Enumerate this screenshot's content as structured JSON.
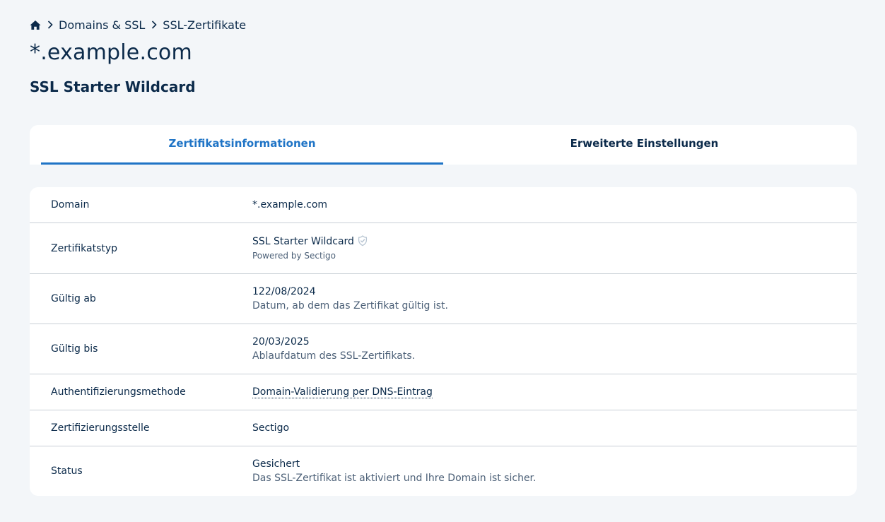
{
  "breadcrumb": {
    "home_icon": "home-icon",
    "items": [
      "Domains & SSL",
      "SSL-Zertifikate"
    ]
  },
  "header": {
    "title": "*.example.com",
    "subtitle": "SSL Starter Wildcard"
  },
  "tabs": [
    {
      "label": "Zertifikatsinformationen",
      "active": true
    },
    {
      "label": "Erweiterte Einstellungen",
      "active": false
    }
  ],
  "details": {
    "domain": {
      "label": "Domain",
      "value": "*.example.com"
    },
    "type": {
      "label": "Zertifikatstyp",
      "value": "SSL Starter Wildcard",
      "powered": "Powered by Sectigo",
      "icon": "sectigo-badge-icon"
    },
    "valid_from": {
      "label": "Gültig ab",
      "value": "122/08/2024",
      "note": "Datum, ab dem das Zertifikat gültig ist."
    },
    "valid_to": {
      "label": "Gültig bis",
      "value": "20/03/2025",
      "note": "Ablaufdatum des SSL-Zertifikats."
    },
    "auth": {
      "label": "Authentifizierungsmethode",
      "value": "Domain-Validierung per DNS-Eintrag"
    },
    "authority": {
      "label": "Zertifizierungsstelle",
      "value": "Sectigo"
    },
    "status": {
      "label": "Status",
      "value": "Gesichert",
      "note": "Das SSL-Zertifikat ist aktiviert und Ihre Domain ist sicher."
    }
  },
  "colors": {
    "accent": "#1f74c6",
    "text": "#0b2a4a",
    "background": "#f3f6f9"
  }
}
